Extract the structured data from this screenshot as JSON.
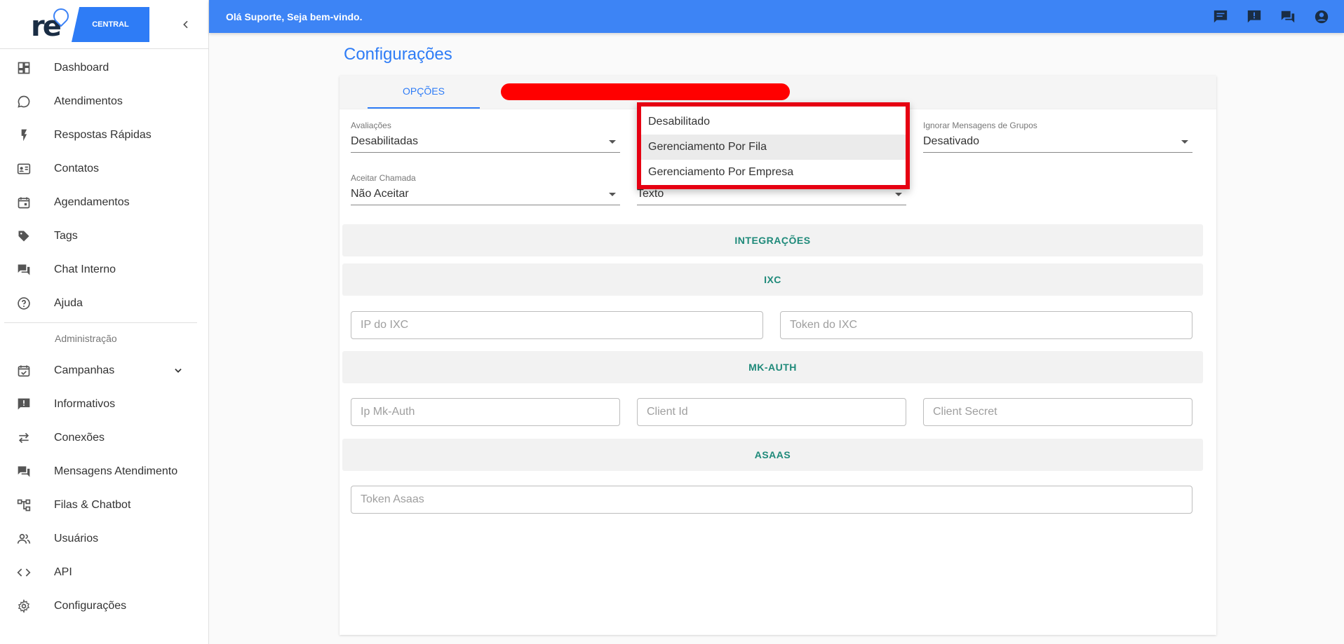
{
  "brand": {
    "logo_text": "re",
    "logo_sub": "CENTRAL"
  },
  "sidebar": {
    "items": [
      {
        "label": "Dashboard",
        "icon": "dashboard-icon"
      },
      {
        "label": "Atendimentos",
        "icon": "whatsapp-icon"
      },
      {
        "label": "Respostas Rápidas",
        "icon": "flash-icon"
      },
      {
        "label": "Contatos",
        "icon": "contact-card-icon"
      },
      {
        "label": "Agendamentos",
        "icon": "calendar-icon"
      },
      {
        "label": "Tags",
        "icon": "tag-icon"
      },
      {
        "label": "Chat Interno",
        "icon": "forum-icon"
      },
      {
        "label": "Ajuda",
        "icon": "help-icon"
      }
    ],
    "admin_header": "Administração",
    "admin_items": [
      {
        "label": "Campanhas",
        "icon": "event-check-icon"
      },
      {
        "label": "Informativos",
        "icon": "announcement-icon"
      },
      {
        "label": "Conexões",
        "icon": "swap-icon"
      },
      {
        "label": "Mensagens Atendimento",
        "icon": "forum-icon"
      },
      {
        "label": "Filas & Chatbot",
        "icon": "account-tree-icon"
      },
      {
        "label": "Usuários",
        "icon": "people-icon"
      },
      {
        "label": "API",
        "icon": "code-icon"
      },
      {
        "label": "Configurações",
        "icon": "gear-icon"
      }
    ]
  },
  "topbar": {
    "welcome": "Olá Suporte, Seja bem-vindo."
  },
  "page": {
    "title": "Configurações"
  },
  "tabs": {
    "options": "OPÇÕES"
  },
  "settings": {
    "avaliacoes": {
      "label": "Avaliações",
      "value": "Desabilitadas"
    },
    "ignorar_grupos": {
      "label": "Ignorar Mensagens de Grupos",
      "value": "Desativado"
    },
    "aceitar_chamada": {
      "label": "Aceitar Chamada",
      "value": "Não Aceitar"
    },
    "tipo_chatbot": {
      "value": "Texto"
    }
  },
  "dropdown": {
    "options": [
      "Desabilitado",
      "Gerenciamento Por Fila",
      "Gerenciamento Por Empresa"
    ],
    "highlighted": "Gerenciamento Por Fila"
  },
  "sections": {
    "integracoes": "INTEGRAÇÕES",
    "ixc": "IXC",
    "mkauth": "MK-AUTH",
    "asaas": "ASAAS"
  },
  "inputs": {
    "ixc_ip": "IP do IXC",
    "ixc_token": "Token do IXC",
    "mk_ip": "Ip Mk-Auth",
    "mk_client_id": "Client Id",
    "mk_client_secret": "Client Secret",
    "asaas_token": "Token Asaas"
  },
  "colors": {
    "primary": "#3d84f5",
    "section_text": "#1f8a7a",
    "highlight_border": "#e60012"
  }
}
